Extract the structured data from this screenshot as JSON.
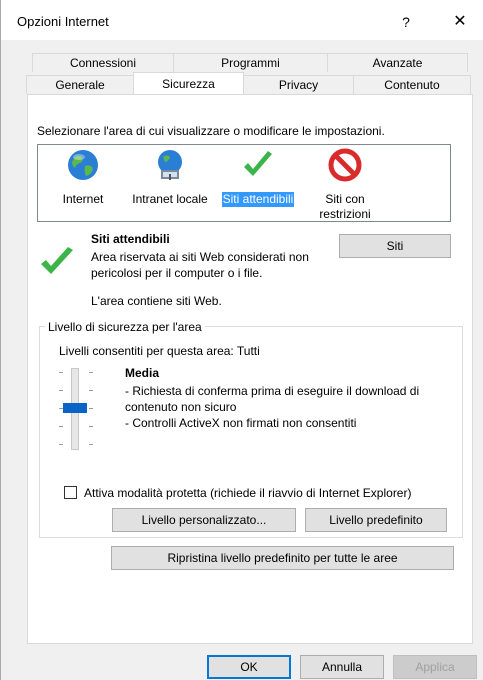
{
  "window": {
    "title": "Opzioni Internet",
    "help": "?",
    "close": "✕"
  },
  "tabs": {
    "row1": [
      "Connessioni",
      "Programmi",
      "Avanzate"
    ],
    "row2": [
      "Generale",
      "Sicurezza",
      "Privacy",
      "Contenuto"
    ],
    "active": "Sicurezza"
  },
  "zones": {
    "prompt": "Selezionare l'area di cui visualizzare o modificare le impostazioni.",
    "items": [
      {
        "label": "Internet",
        "icon": "globe-icon"
      },
      {
        "label": "Intranet locale",
        "icon": "network-globe-icon"
      },
      {
        "label": "Siti attendibili",
        "icon": "green-check-icon",
        "selected": true
      },
      {
        "label_line1": "Siti con",
        "label_line2": "restrizioni",
        "icon": "restricted-icon"
      }
    ]
  },
  "selected_zone": {
    "title": "Siti attendibili",
    "desc_line1": "Area riservata ai siti Web considerati non",
    "desc_line2": "pericolosi per il computer o i file.",
    "contains": "L'area contiene siti Web.",
    "sites_button": "Siti"
  },
  "security_level": {
    "legend": "Livello di sicurezza per l'area",
    "allowed": "Livelli consentiti per questa area: Tutti",
    "level_name": "Media",
    "lines": [
      "- Richiesta di conferma prima di eseguire il download di",
      "contenuto non sicuro",
      "- Controlli ActiveX non firmati non consentiti"
    ],
    "slider_position": "Media",
    "protected_mode_label": "Attiva modalità protetta (richiede il riavvio di Internet Explorer)",
    "protected_mode_checked": false,
    "custom_button": "Livello personalizzato...",
    "default_button": "Livello predefinito",
    "reset_all_button": "Ripristina livello predefinito per tutte le aree"
  },
  "footer": {
    "ok": "OK",
    "cancel": "Annulla",
    "apply": "Applica"
  },
  "colors": {
    "accent": "#0078d7",
    "selection": "#3399ff",
    "check_green": "#3bb54a",
    "restricted_red": "#d92b2b"
  }
}
